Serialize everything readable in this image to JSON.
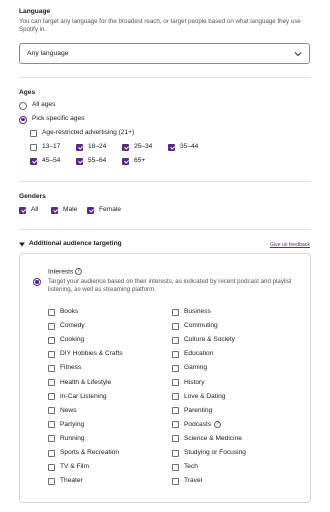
{
  "language": {
    "heading": "Language",
    "description": "You can target any language for the broadest reach, or target people based on what language they use Spotify in.",
    "selected": "Any language",
    "chevron_icon": "chevron-down-icon"
  },
  "ages": {
    "heading": "Ages",
    "options": [
      "All ages",
      "Pick specific ages"
    ],
    "selected_option": "Pick specific ages",
    "restricted_label": "Age-restricted advertising (21+)",
    "restricted_checked": false,
    "ranges": [
      {
        "label": "13–17",
        "checked": false
      },
      {
        "label": "18–24",
        "checked": true
      },
      {
        "label": "25–34",
        "checked": true
      },
      {
        "label": "35–44",
        "checked": true
      },
      {
        "label": "45–54",
        "checked": true
      },
      {
        "label": "55–64",
        "checked": true
      },
      {
        "label": "65+",
        "checked": true
      }
    ]
  },
  "genders": {
    "heading": "Genders",
    "options": [
      {
        "label": "All",
        "checked": true
      },
      {
        "label": "Male",
        "checked": true
      },
      {
        "label": "Female",
        "checked": true
      }
    ]
  },
  "additional": {
    "heading": "Additional audience targeting",
    "feedback_link": "Give us feedback",
    "toggle_icon": "caret-down-icon"
  },
  "interests": {
    "heading": "Interests",
    "help_icon": "info-circle-icon",
    "description": "Target your audience based on their interests, as indicated by recent podcast and playlist listening, as well as streaming platform.",
    "left": [
      "Books",
      "Comedy",
      "Cooking",
      "DIY Hobbies & Crafts",
      "Fitness",
      "Health & Lifestyle",
      "In-Car Listening",
      "News",
      "Partying",
      "Running",
      "Sports & Recreation",
      "TV & Film",
      "Theater"
    ],
    "right": [
      "Business",
      "Commuting",
      "Culture & Society",
      "Education",
      "Gaming",
      "History",
      "Love & Dating",
      "Parenting",
      "Podcasts",
      "Science & Medicine",
      "Studying or Focusing",
      "Tech",
      "Travel"
    ]
  },
  "colors": {
    "accent": "#5b2a86",
    "border": "#d8d8d8",
    "text": "#1a1a1a"
  }
}
